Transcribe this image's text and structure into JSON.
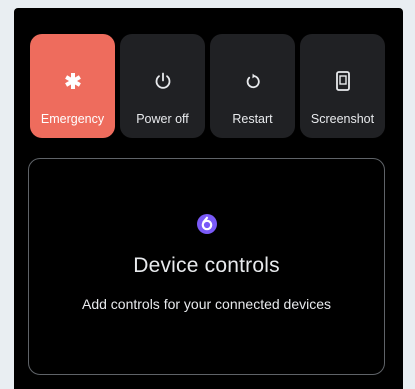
{
  "power_menu": {
    "actions": [
      {
        "label": "Emergency",
        "icon": "asterisk-icon",
        "color": "#ee6c5d"
      },
      {
        "label": "Power off",
        "icon": "power-icon"
      },
      {
        "label": "Restart",
        "icon": "restart-icon"
      },
      {
        "label": "Screenshot",
        "icon": "screenshot-icon"
      }
    ]
  },
  "device_controls": {
    "title": "Device controls",
    "subtitle": "Add controls for your connected devices",
    "icon": "device-controls-app-icon",
    "accent": "#7a5af8"
  }
}
